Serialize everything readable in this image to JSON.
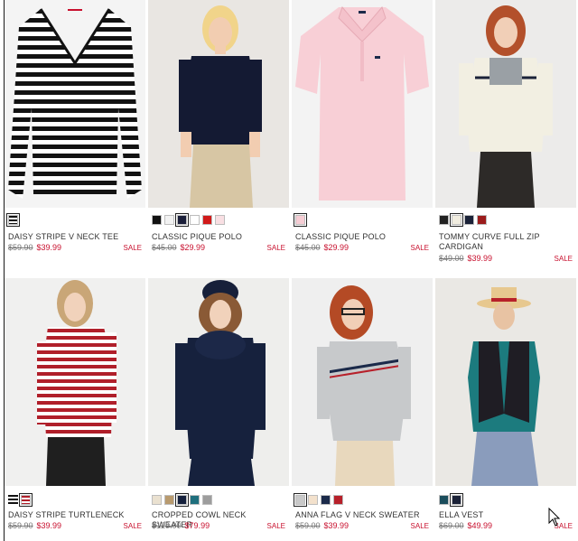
{
  "products": [
    {
      "name": "DAISY STRIPE V NECK TEE",
      "old_price": "$59.90",
      "new_price": "$39.99",
      "sale": "SALE",
      "swatches": [
        {
          "icon": "stripe-swatch",
          "color": "#ffffff"
        }
      ]
    },
    {
      "name": "CLASSIC PIQUE POLO",
      "old_price": "$45.00",
      "new_price": "$29.99",
      "sale": "SALE",
      "swatches": [
        {
          "color": "#111111"
        },
        {
          "color": "#f2f2f2"
        },
        {
          "color": "#1b1f3a",
          "selected": true
        },
        {
          "color": "#ffffff"
        },
        {
          "color": "#d11a1a"
        },
        {
          "color": "#f9dfe3"
        }
      ]
    },
    {
      "name": "CLASSIC PIQUE POLO",
      "old_price": "$45.00",
      "new_price": "$29.99",
      "sale": "SALE",
      "swatches": [
        {
          "color": "#f6cdd4",
          "selected": true
        }
      ]
    },
    {
      "name": "TOMMY CURVE FULL ZIP CARDIGAN",
      "old_price": "$49.00",
      "new_price": "$39.99",
      "sale": "SALE",
      "swatches": [
        {
          "color": "#222222"
        },
        {
          "color": "#f1ede0",
          "selected": true
        },
        {
          "color": "#1b2238"
        },
        {
          "color": "#9b1c1c"
        }
      ]
    },
    {
      "name": "DAISY STRIPE TURTLENECK",
      "old_price": "$59.90",
      "new_price": "$39.99",
      "sale": "SALE",
      "swatches": [
        {
          "icon": "stripe-swatch",
          "color": "#ffffff"
        },
        {
          "icon": "stripe-swatch-red",
          "color": "#ffffff",
          "selected": true
        }
      ]
    },
    {
      "name": "CROPPED COWL NECK SWEATER",
      "old_price": "$129.00",
      "new_price": "$79.99",
      "sale": "SALE",
      "swatches": [
        {
          "color": "#eae1d0"
        },
        {
          "color": "#b89a6e"
        },
        {
          "color": "#16213d",
          "selected": true
        },
        {
          "color": "#1f6f7d"
        },
        {
          "color": "#9d9d9d"
        }
      ]
    },
    {
      "name": "ANNA FLAG V NECK SWEATER",
      "old_price": "$59.00",
      "new_price": "$39.99",
      "sale": "SALE",
      "swatches": [
        {
          "color": "#c9c9c9",
          "selected": true
        },
        {
          "color": "#f3e1cc"
        },
        {
          "color": "#1b2a4a"
        },
        {
          "color": "#b7202a"
        }
      ]
    },
    {
      "name": "ELLA VEST",
      "old_price": "$69.00",
      "new_price": "$49.99",
      "sale": "SALE",
      "swatches": [
        {
          "color": "#1b4d5c"
        },
        {
          "color": "#1b2238",
          "selected": true
        }
      ]
    }
  ],
  "colors": {
    "sale": "#c8102e",
    "text": "#333333"
  }
}
